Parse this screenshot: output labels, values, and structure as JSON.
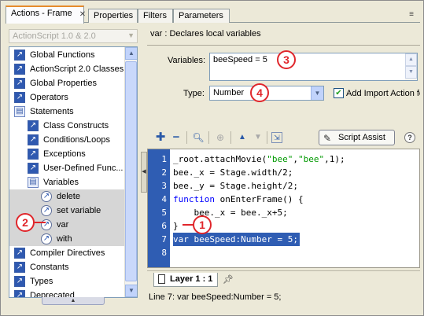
{
  "tabs": [
    {
      "label": "Actions - Frame",
      "active": true
    },
    {
      "label": "Properties",
      "active": false
    },
    {
      "label": "Filters",
      "active": false
    },
    {
      "label": "Parameters",
      "active": false
    }
  ],
  "left_panel": {
    "version_select": "ActionScript 1.0 & 2.0",
    "tree": [
      {
        "label": "Global Functions",
        "icon": "book-closed-icon",
        "indent": 0
      },
      {
        "label": "ActionScript 2.0 Classes",
        "icon": "book-closed-icon",
        "indent": 0
      },
      {
        "label": "Global Properties",
        "icon": "book-closed-icon",
        "indent": 0
      },
      {
        "label": "Operators",
        "icon": "book-closed-icon",
        "indent": 0
      },
      {
        "label": "Statements",
        "icon": "book-open-icon",
        "indent": 0
      },
      {
        "label": "Class Constructs",
        "icon": "book-closed-icon",
        "indent": 1
      },
      {
        "label": "Conditions/Loops",
        "icon": "book-closed-icon",
        "indent": 1
      },
      {
        "label": "Exceptions",
        "icon": "book-closed-icon",
        "indent": 1
      },
      {
        "label": "User-Defined Func...",
        "icon": "book-closed-icon",
        "indent": 1
      },
      {
        "label": "Variables",
        "icon": "book-open-icon",
        "indent": 1
      },
      {
        "label": "delete",
        "icon": "action-icon",
        "indent": 2
      },
      {
        "label": "set variable",
        "icon": "action-icon",
        "indent": 2
      },
      {
        "label": "var",
        "icon": "action-icon",
        "indent": 2
      },
      {
        "label": "with",
        "icon": "action-icon",
        "indent": 2
      },
      {
        "label": "Compiler Directives",
        "icon": "book-closed-icon",
        "indent": 0
      },
      {
        "label": "Constants",
        "icon": "book-closed-icon",
        "indent": 0
      },
      {
        "label": "Types",
        "icon": "book-closed-icon",
        "indent": 0
      },
      {
        "label": "Deprecated",
        "icon": "book-closed-icon",
        "indent": 0
      }
    ]
  },
  "description": "var : Declares local variables",
  "form": {
    "variables_label": "Variables:",
    "variables_value": "beeSpeed = 5",
    "type_label": "Type:",
    "type_value": "Number",
    "add_import_label": "Add Import Action fo",
    "add_import_checked": true
  },
  "toolbar": {
    "script_assist_label": "Script Assist",
    "help_label": "?"
  },
  "code": {
    "lines": [
      {
        "n": "1",
        "text": "_root.attachMovie(\"bee\",\"bee\",1);"
      },
      {
        "n": "2",
        "text": "bee._x = Stage.width/2;"
      },
      {
        "n": "3",
        "text": "bee._y = Stage.height/2;"
      },
      {
        "n": "4",
        "text": "function onEnterFrame() {"
      },
      {
        "n": "5",
        "text": "    bee._x = bee._x+5;"
      },
      {
        "n": "6",
        "text": "}"
      },
      {
        "n": "7",
        "text": "var beeSpeed:Number = 5;"
      },
      {
        "n": "8",
        "text": ""
      }
    ],
    "highlighted_line": 7
  },
  "layer_tab": "Layer 1 : 1",
  "status_line": "Line 7: var beeSpeed:Number = 5;",
  "callouts": [
    "1",
    "2",
    "3",
    "4"
  ],
  "colors": {
    "callout": "#e0262b",
    "gutter": "#2f5db3",
    "keyword": "#0000ff",
    "string": "#009900",
    "active_tab_accent": "#e68b2c"
  }
}
